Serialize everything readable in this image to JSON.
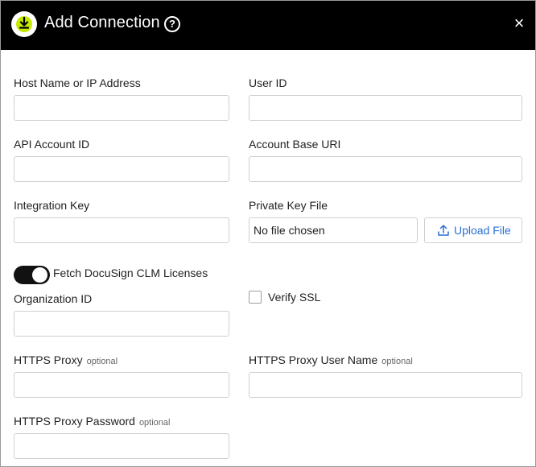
{
  "dialog": {
    "title": "Add Connection",
    "help_icon_glyph": "?",
    "close_glyph": "×"
  },
  "fields": {
    "host_name": {
      "label": "Host Name or IP Address",
      "value": ""
    },
    "user_id": {
      "label": "User ID",
      "value": ""
    },
    "api_account_id": {
      "label": "API Account ID",
      "value": ""
    },
    "account_base_uri": {
      "label": "Account Base URI",
      "value": ""
    },
    "integration_key": {
      "label": "Integration Key",
      "value": ""
    },
    "private_key_file": {
      "label": "Private Key File",
      "file_status": "No file chosen",
      "upload_label": "Upload File"
    },
    "fetch_licenses": {
      "label": "Fetch DocuSign CLM Licenses",
      "on": true
    },
    "organization_id": {
      "label": "Organization ID",
      "value": ""
    },
    "verify_ssl": {
      "label": "Verify SSL",
      "checked": false
    },
    "https_proxy": {
      "label": "HTTPS Proxy",
      "optional": "optional",
      "value": ""
    },
    "https_proxy_user": {
      "label": "HTTPS Proxy User Name",
      "optional": "optional",
      "value": ""
    },
    "https_proxy_password": {
      "label": "HTTPS Proxy Password",
      "optional": "optional",
      "value": ""
    }
  },
  "colors": {
    "header_bg": "#000000",
    "accent_icon": "#c7e800",
    "link_blue": "#2a6fd4"
  },
  "icons": {
    "app": "download-icon",
    "help": "help-icon",
    "close": "close-icon",
    "upload": "upload-icon"
  }
}
